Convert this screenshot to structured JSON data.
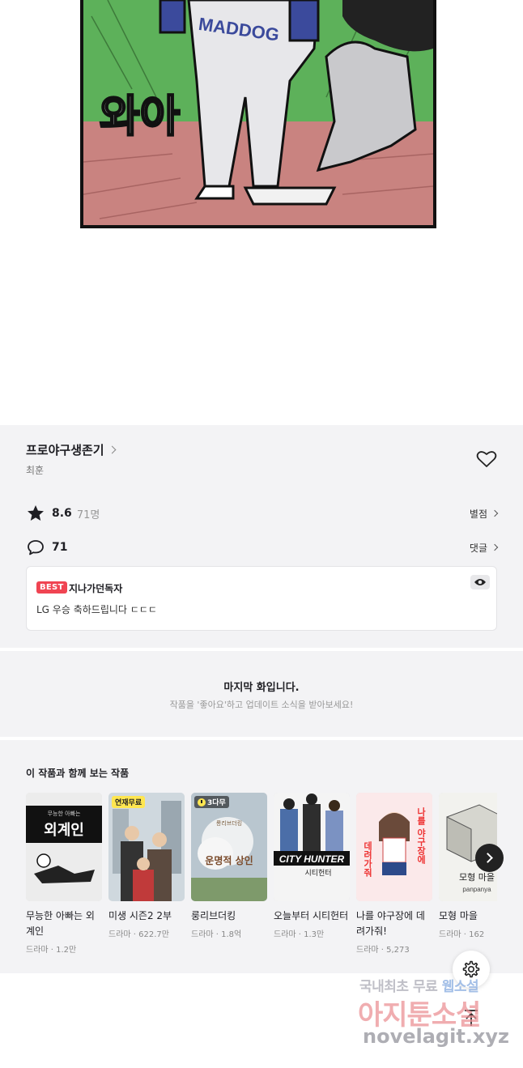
{
  "comic": {
    "sfx_text": "와아",
    "shirt_text": "MADDOG"
  },
  "work": {
    "title": "프로야구생존기",
    "author": "최훈",
    "rating": "8.6",
    "rating_count": "71명",
    "rating_link": "별점",
    "comment_count": "71",
    "comment_link": "댓글"
  },
  "best_comment": {
    "badge": "BEST",
    "user": "지나가던독자",
    "text": "LG 우승 축하드립니다 ㄷㄷㄷ"
  },
  "last_episode": {
    "title": "마지막 화입니다.",
    "subtitle": "작품을 '좋아요'하고 업데이트 소식을 받아보세요!"
  },
  "recommendations": {
    "heading": "이 작품과 함께 보는 작품",
    "items": [
      {
        "title": "무능한 아빠는 외계인",
        "meta": "드라마 · 1.2만",
        "badge": "",
        "cover_text": "외계인",
        "cover_small": "무능한 아빠는"
      },
      {
        "title": "미생 시즌2 2부",
        "meta": "드라마 · 622.7만",
        "badge": "연재무료",
        "cover_text": "",
        "cover_small": ""
      },
      {
        "title": "룽리브더킹",
        "meta": "드라마 · 1.8억",
        "badge": "3다무",
        "cover_text": "운명적 상인",
        "cover_small": "롱리브더킹"
      },
      {
        "title": "오늘부터 시티헌터",
        "meta": "드라마 · 1.3만",
        "badge": "",
        "cover_text": "CITY HUNTER",
        "cover_small": "시티헌터"
      },
      {
        "title": "나를 야구장에 데려가줘!",
        "meta": "드라마 · 5,273",
        "badge": "",
        "cover_text": "나를 야구장에",
        "cover_small": "데려가줘"
      },
      {
        "title": "모형 마을",
        "meta": "드라마 · 162",
        "badge": "",
        "cover_text": "모형 마을",
        "cover_small": "panpanya"
      }
    ]
  },
  "watermark": {
    "line1_a": "국내최초 무료",
    "line1_b": "웹소설",
    "line2": "아지툰소설",
    "line3": "novelagit.xyz"
  },
  "icons": [
    "chevron-right-icon",
    "heart-icon",
    "star-icon",
    "comment-icon",
    "eye-icon",
    "gear-icon",
    "arrow-up-icon"
  ],
  "colors": {
    "background_section": "#f3f3f5",
    "best_badge": "#f04452",
    "free_badge": "#ffe650"
  }
}
